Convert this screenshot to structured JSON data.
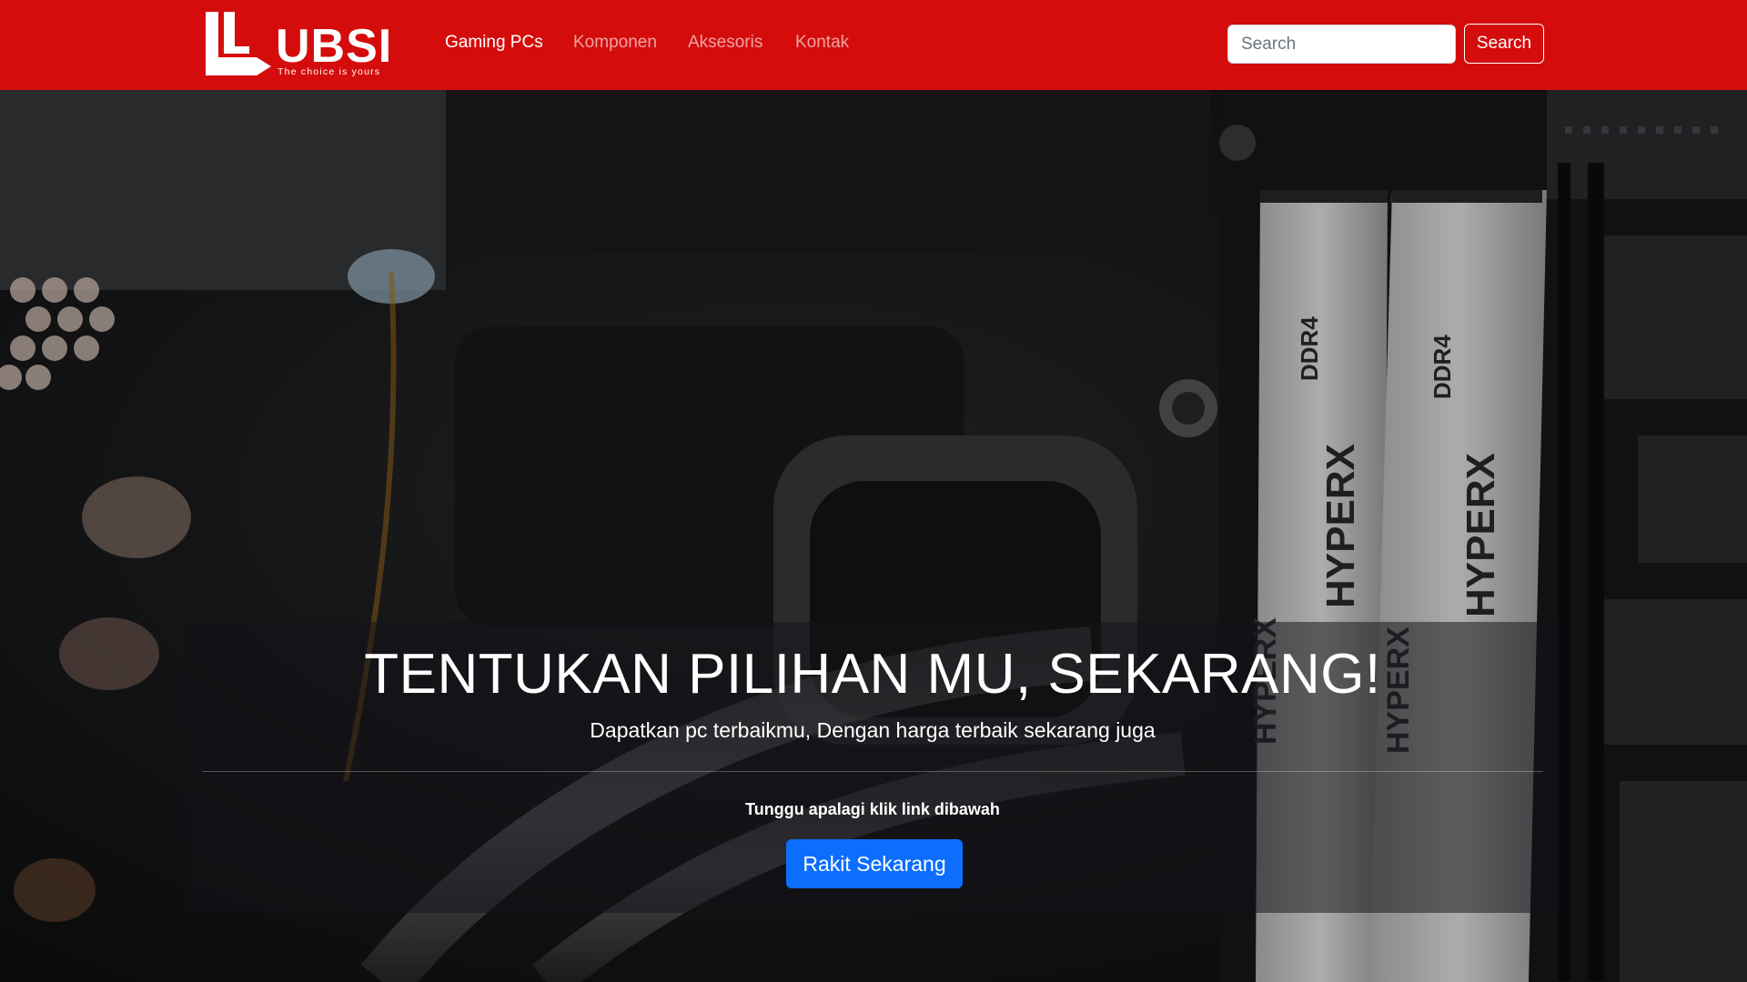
{
  "brand": {
    "name": "UBSI",
    "tagline": "The choice is yours"
  },
  "nav": {
    "links": [
      {
        "label": "Gaming PCs",
        "active": true
      },
      {
        "label": "Komponen",
        "active": false
      },
      {
        "label": "Aksesoris",
        "active": false
      },
      {
        "label": "Kontak",
        "active": false
      }
    ]
  },
  "search": {
    "placeholder": "Search",
    "value": "",
    "button_label": "Search"
  },
  "hero": {
    "title": "TENTUKAN PILIHAN MU, SEKARANG!",
    "subtitle": "Dapatkan pc terbaikmu, Dengan harga terbaik sekarang juga",
    "note": "Tunggu apalagi klik link dibawah",
    "cta_label": "Rakit Sekarang",
    "ram_labels": [
      "DDR4",
      "HYPERX"
    ]
  },
  "colors": {
    "navbar": "#d50c0c",
    "cta": "#0d6efd"
  },
  "icons": {
    "logo": "ubsi-logo-icon"
  }
}
